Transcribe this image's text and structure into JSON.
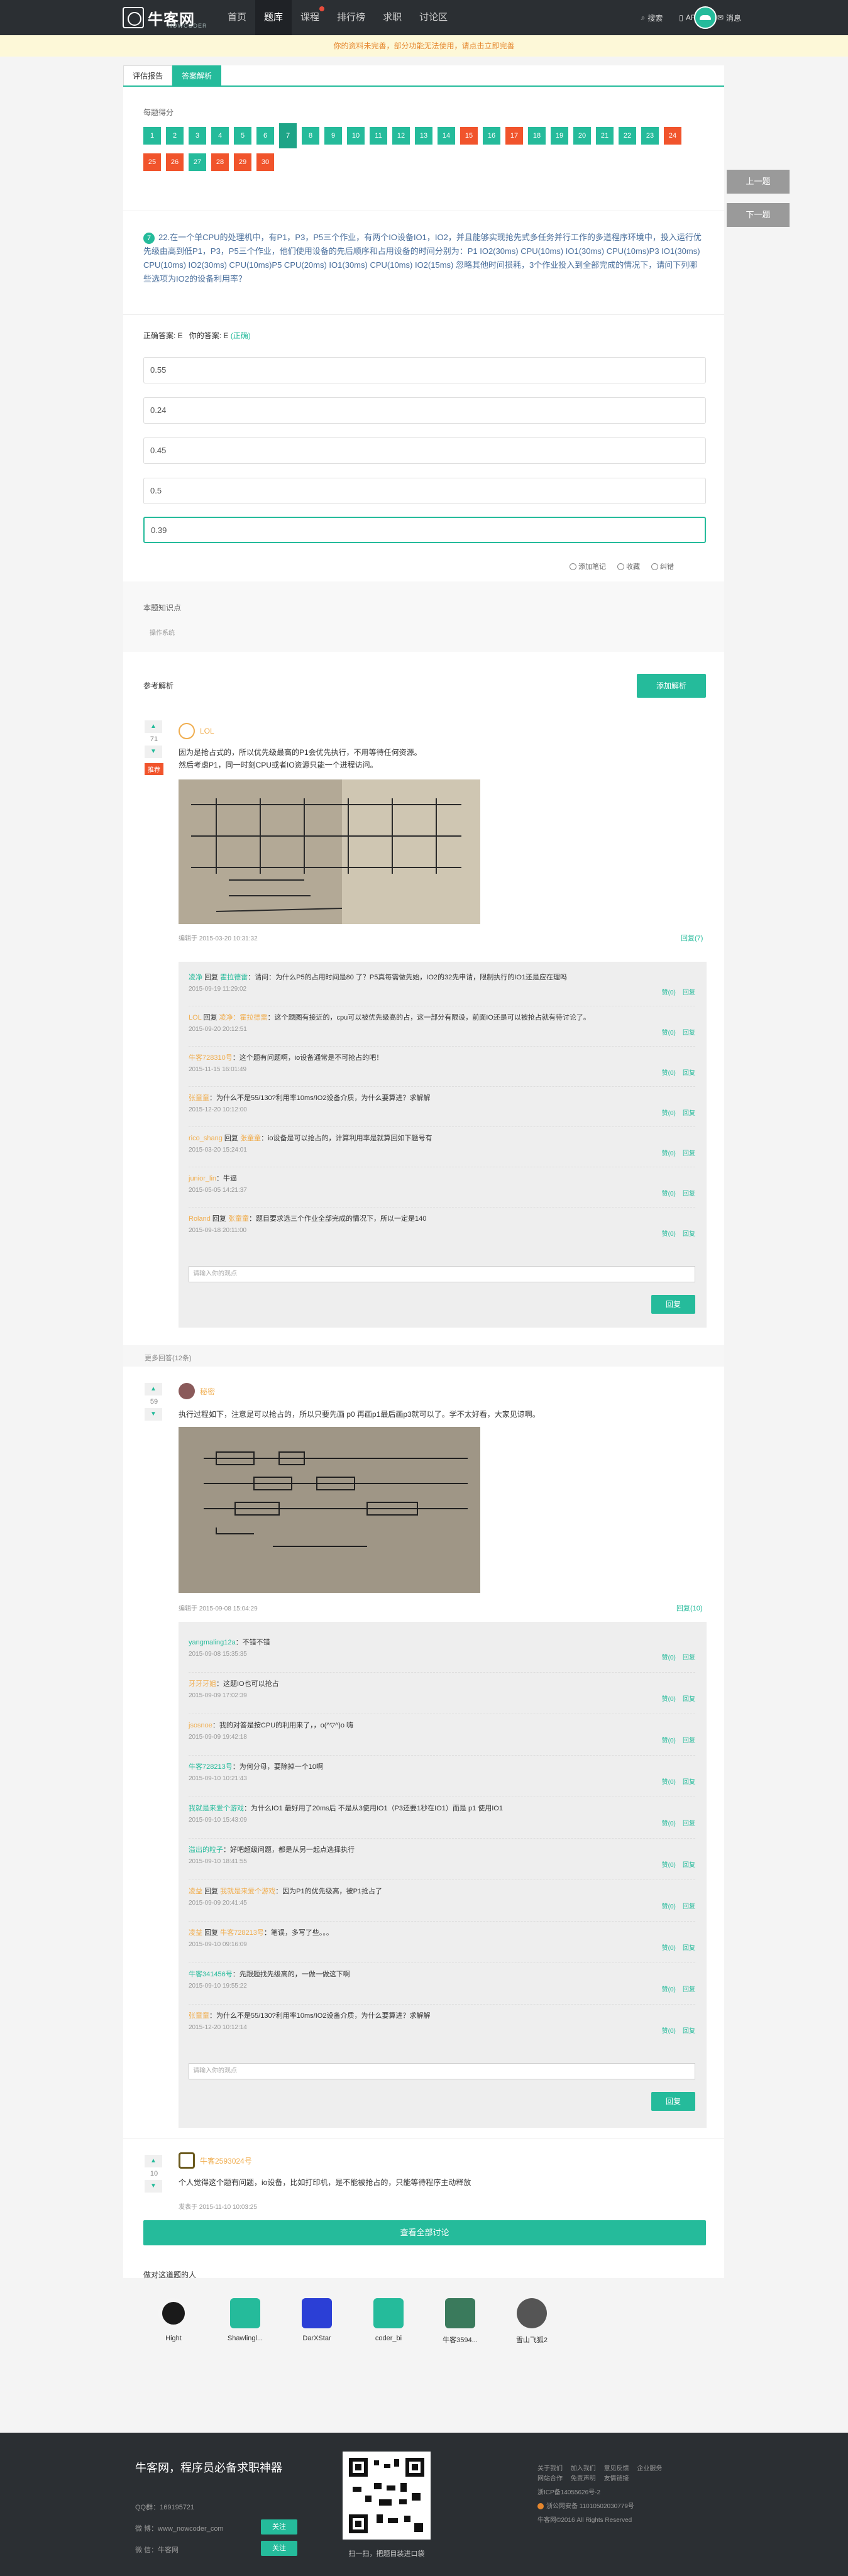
{
  "header": {
    "logo_text": "牛客网",
    "logo_sub": "NOWCODER",
    "nav": [
      "首页",
      "题库",
      "课程",
      "排行榜",
      "求职",
      "讨论区"
    ],
    "search": "搜索",
    "app": "APP",
    "messages": "消息"
  },
  "notice": {
    "text": "你的资料未完善，部分功能无法使用，请点击",
    "link": "立即完善"
  },
  "tabs": [
    "评估报告",
    "答案解析"
  ],
  "scores": {
    "label": "每题得分",
    "items": [
      {
        "n": "1",
        "s": "ok"
      },
      {
        "n": "2",
        "s": "ok"
      },
      {
        "n": "3",
        "s": "ok"
      },
      {
        "n": "4",
        "s": "ok"
      },
      {
        "n": "5",
        "s": "ok"
      },
      {
        "n": "6",
        "s": "ok"
      },
      {
        "n": "7",
        "s": "cur"
      },
      {
        "n": "8",
        "s": "ok"
      },
      {
        "n": "9",
        "s": "ok"
      },
      {
        "n": "10",
        "s": "ok"
      },
      {
        "n": "11",
        "s": "ok"
      },
      {
        "n": "12",
        "s": "ok"
      },
      {
        "n": "13",
        "s": "ok"
      },
      {
        "n": "14",
        "s": "ok"
      },
      {
        "n": "15",
        "s": "wrong"
      },
      {
        "n": "16",
        "s": "ok"
      },
      {
        "n": "17",
        "s": "wrong"
      },
      {
        "n": "18",
        "s": "ok"
      },
      {
        "n": "19",
        "s": "ok"
      },
      {
        "n": "20",
        "s": "ok"
      },
      {
        "n": "21",
        "s": "ok"
      },
      {
        "n": "22",
        "s": "ok"
      },
      {
        "n": "23",
        "s": "ok"
      },
      {
        "n": "24",
        "s": "wrong"
      },
      {
        "n": "25",
        "s": "wrong"
      },
      {
        "n": "26",
        "s": "wrong"
      },
      {
        "n": "27",
        "s": "ok"
      },
      {
        "n": "28",
        "s": "wrong"
      },
      {
        "n": "29",
        "s": "wrong"
      },
      {
        "n": "30",
        "s": "wrong"
      }
    ]
  },
  "side": {
    "prev": "上一题",
    "next": "下一题"
  },
  "question": {
    "num": "7",
    "text": "22.在一个单CPU的处理机中，有P1，P3，P5三个作业，有两个IO设备IO1，IO2，并且能够实现抢先式多任务并行工作的多道程序环境中，投入运行优先级由高到低P1，P3，P5三个作业，他们使用设备的先后顺序和占用设备的时间分别为：P1 IO2(30ms) CPU(10ms) IO1(30ms) CPU(10ms)P3 IO1(30ms) CPU(10ms) IO2(30ms) CPU(10ms)P5 CPU(20ms) IO1(30ms) CPU(10ms) IO2(15ms) 忽略其他时间损耗，3个作业投入到全部完成的情况下，请问下列哪些选项为IO2的设备利用率？"
  },
  "answer": {
    "correct_label": "正确答案: E",
    "your_label": "你的答案: E",
    "ok": "(正确)"
  },
  "options": [
    "0.55",
    "0.24",
    "0.45",
    "0.5",
    "0.39"
  ],
  "option_actions": [
    "添加笔记",
    "收藏",
    "纠错"
  ],
  "knowledge": {
    "title": "本题知识点",
    "tag": "操作系统"
  },
  "analysis": {
    "title": "参考解析",
    "add_button": "添加解析"
  },
  "post1": {
    "votes": "71",
    "tag": "推荐",
    "author": "LOL",
    "text1": "因为是抢占式的，所以优先级最高的P1会优先执行，不用等待任何资源。",
    "text2": "然后考虑P1，同一时刻CPU或者IO资源只能一个进程访问。",
    "meta": "编辑于 2015-03-20 10:31:32",
    "reply": "回复(7)",
    "comments": [
      {
        "name": "凌净",
        "color": "g",
        "mid": "回复",
        "to": "霍拉德雷",
        "text": "：请问：为什么P5的占用时间是80 了？P5真每需做先始，IO2的32先申请，限制执行的IO1还是应在理吗",
        "time": "2015-09-19 11:29:02"
      },
      {
        "name": "LOL",
        "color": "o",
        "mid": "回复",
        "to": "凌净：霍拉德雷",
        "text": "：这个题图有接近的，cpu可以被优先级高的占，这一部分有限设，前面IO还是可以被抢占就有待讨论了。",
        "time": "2015-09-20 20:12:51"
      },
      {
        "name": "牛客728310号",
        "color": "o",
        "mid": "",
        "to": "",
        "text": "：这个题有问题啊，io设备通常是不可抢占的吧！",
        "time": "2015-11-15 16:01:49"
      },
      {
        "name": "张童童",
        "color": "o",
        "mid": "",
        "to": "",
        "text": "：为什么不是55/130?利用率10ms/IO2设备介质，为什么要算进？求解解",
        "time": "2015-12-20 10:12:00"
      },
      {
        "name": "rico_shang",
        "color": "o",
        "mid": "回复",
        "to": "张童童",
        "text": "：io设备是可以抢占的，计算利用率是就算回如下题号有",
        "time": "2015-03-20 15:24:01"
      },
      {
        "name": "junior_lin",
        "color": "o",
        "mid": "",
        "to": "",
        "text": "：牛逼",
        "time": "2015-05-05 14:21:37"
      },
      {
        "name": "Roland",
        "color": "o",
        "mid": "回复",
        "to": "张童童",
        "text": "：题目要求选三个作业全部完成的情况下，所以一定是140",
        "time": "2015-09-18 20:11:00"
      }
    ],
    "input_placeholder": "请输入你的观点",
    "submit": "回复"
  },
  "more_label": "更多回答(12条)",
  "post2": {
    "votes": "59",
    "author": "秘密",
    "text": "执行过程如下，注意是可以抢占的，所以只要先画 p0 再画p1最后画p3就可以了。学不太好看，大家见谅啊。",
    "meta": "编辑于 2015-09-08 15:04:29",
    "reply": "回复(10)",
    "comments": [
      {
        "name": "yangmaling12a",
        "color": "g",
        "mid": "",
        "to": "",
        "text": "：不错不错",
        "time": "2015-09-08 15:35:35"
      },
      {
        "name": "牙牙牙姐",
        "color": "o",
        "mid": "",
        "to": "",
        "text": "：这题IO也可以抢占",
        "time": "2015-09-09 17:02:39"
      },
      {
        "name": "jsosnoe",
        "color": "o",
        "mid": "",
        "to": "",
        "text": "：我的对答是按CPU的利用来了，，o(^▽^)o 嗨",
        "time": "2015-09-09 19:42:18"
      },
      {
        "name": "牛客728213号",
        "color": "g",
        "mid": "",
        "to": "",
        "text": "：为何分母，要除掉一个10啊",
        "time": "2015-09-10 10:21:43"
      },
      {
        "name": "我就是来爱个游戏",
        "color": "g",
        "mid": "",
        "to": "",
        "text": "：为什么IO1 最好用了20ms后 不是从3使用IO1（P3还要1秒在IO1）而是 p1 使用IO1",
        "time": "2015-09-10 15:43:09"
      },
      {
        "name": "溢出的粒子",
        "color": "g",
        "mid": "",
        "to": "",
        "text": "：好吧超级问题，都是从另一起点选择执行",
        "time": "2015-09-10 18:41:55"
      },
      {
        "name": "凌益",
        "color": "o",
        "mid": "回复",
        "to": "我就是来爱个游戏",
        "text": "：因为P1的优先级高，被P1抢占了",
        "time": "2015-09-09 20:41:45"
      },
      {
        "name": "凌益",
        "color": "o",
        "mid": "回复",
        "to": "牛客728213号",
        "text": "：笔误，多写了些。。。",
        "time": "2015-09-10 09:16:09"
      },
      {
        "name": "牛客341456号",
        "color": "g",
        "mid": "",
        "to": "",
        "text": "：先跟题找先级高的，一做一做这下啊",
        "time": "2015-09-10 19:55:22"
      },
      {
        "name": "张童童",
        "color": "o",
        "mid": "",
        "to": "",
        "text": "：为什么不是55/130?利用率10ms/IO2设备介质，为什么要算进？求解解",
        "time": "2015-12-20 10:12:14"
      }
    ],
    "input_placeholder": "请输入你的观点",
    "submit": "回复"
  },
  "post3": {
    "votes": "10",
    "author": "牛客2593024号",
    "text": "个人觉得这个题有问题，io设备，比如打印机，是不能被抢占的，只能等待程序主动释放",
    "meta": "发表于 2015-11-10 10:03:25"
  },
  "view_all": "查看全部讨论",
  "viewers_title": "做对这道题的人",
  "viewers": [
    "Hight",
    "Shawlingl...",
    "DarXStar",
    "coder_bi",
    "牛客3594...",
    "雪山飞狐2"
  ],
  "footer": {
    "title": "牛客网，程序员必备求职神器",
    "qq": "QQ群：169195721",
    "weibo": "微 博：www_nowcoder_com",
    "wechat": "微 信：牛客网",
    "follow": "关注",
    "qr_caption": "扫一扫，把题目装进口袋",
    "links": [
      "关于我们",
      "加入我们",
      "意见反馈",
      "企业服务",
      "网站合作",
      "免责声明",
      "友情链接"
    ],
    "icp": "浙ICP备14055626号-2",
    "police": "浙公网安备 11010502030779号",
    "copyright": "牛客网©2016 All Rights Reserved"
  }
}
